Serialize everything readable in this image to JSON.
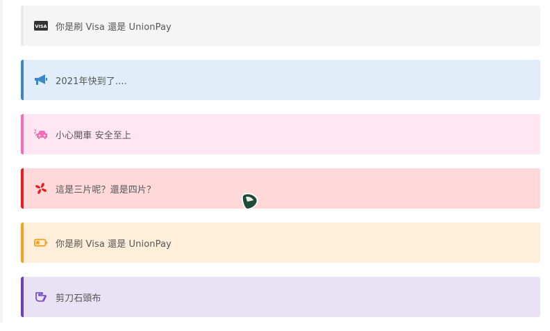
{
  "callouts": [
    {
      "icon": "credit-card-icon",
      "text": "你是刷 Visa 還是 UnionPay",
      "accent": "#e8e8e8",
      "background": "#f5f5f5",
      "icon_label": "VISA"
    },
    {
      "icon": "megaphone-icon",
      "text": "2021年快到了....",
      "accent": "#3d87c6",
      "background": "#e1edf8"
    },
    {
      "icon": "car-crash-icon",
      "text": "小心開車 安全至上",
      "accent": "#f36fb5",
      "background": "#ffe6f2"
    },
    {
      "icon": "fan-icon",
      "text": "這是三片呢？還是四片？",
      "accent": "#e62020",
      "background": "#ffd9d9"
    },
    {
      "icon": "battery-icon",
      "text": "你是刷 Visa 還是 UnionPay",
      "accent": "#f5a020",
      "background": "#ffeeda"
    },
    {
      "icon": "hand-pointing-icon",
      "text": "剪刀石頭布",
      "accent": "#6b40c0",
      "background": "#e8e2f4"
    }
  ]
}
